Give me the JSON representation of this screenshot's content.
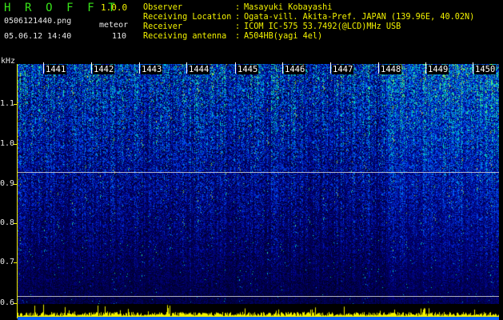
{
  "header": {
    "app_title": "H R O F F T",
    "version": "1.0.0",
    "file_name": "0506121440.png",
    "detect_label": "meteor",
    "timestamp": "05.06.12 14:40",
    "count": "110"
  },
  "metadata": [
    {
      "key": "Observer",
      "sep": ":",
      "value": "Masayuki Kobayashi"
    },
    {
      "key": "Receiving Location",
      "sep": ":",
      "value": "Ogata-vill. Akita-Pref. JAPAN (139.96E, 40.02N)"
    },
    {
      "key": "Receiver",
      "sep": ":",
      "value": "ICOM IC-575 53.7492(@LCD)MHz USB"
    },
    {
      "key": "Receiving antenna",
      "sep": ":",
      "value": "A504HB(yagi 4el)"
    }
  ],
  "frequency_axis": {
    "unit": "kHz",
    "ticks": [
      "1.1",
      "1.0",
      "0.9",
      "0.8",
      "0.7",
      "0.6"
    ]
  },
  "time_axis": {
    "labels": [
      "1441",
      "1442",
      "1443",
      "1444",
      "1445",
      "1446",
      "1447",
      "1448",
      "1449",
      "1450"
    ]
  },
  "colors": {
    "title": "#39e61a",
    "version": "#f2f200",
    "text": "#e8e8e8",
    "axis": "#f2f200",
    "spectro_low": "#000033",
    "spectro_mid": "#0a40ff",
    "spectro_high": "#20e0c0",
    "spectro_peak": "#f2f200"
  }
}
